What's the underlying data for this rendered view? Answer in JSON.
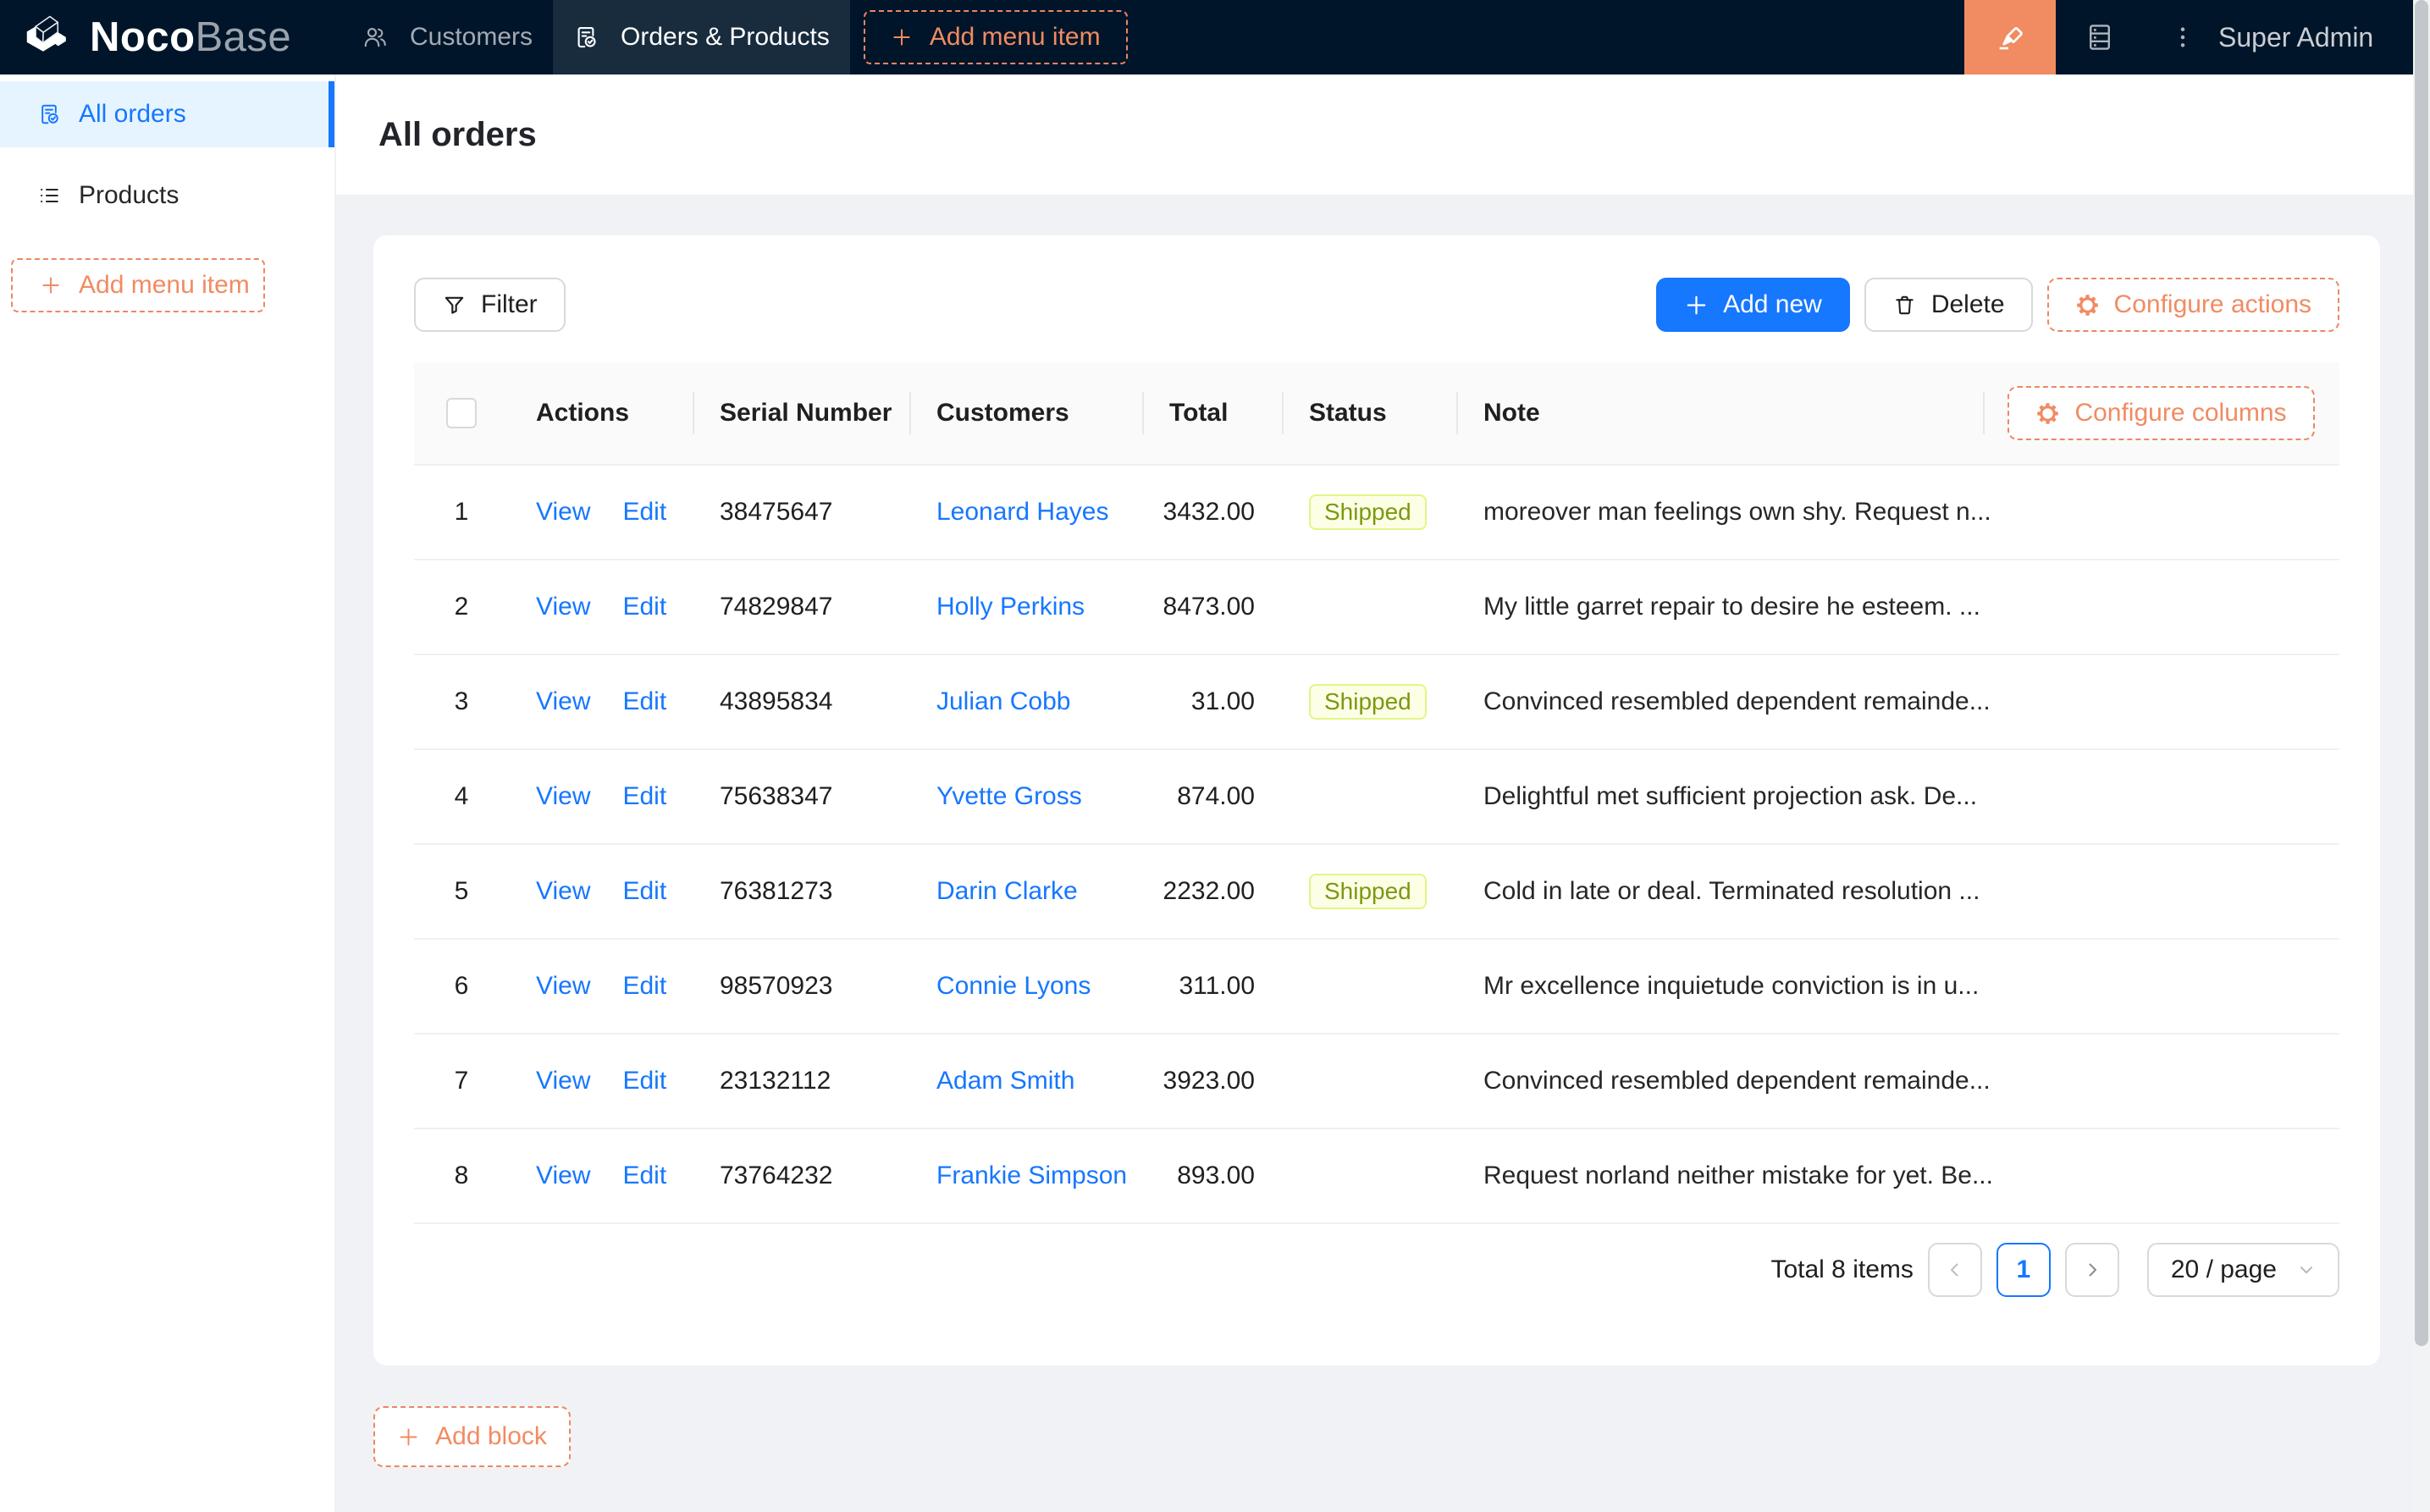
{
  "header": {
    "brand": {
      "bold": "Noco",
      "light": "Base"
    },
    "tabs": [
      {
        "label": "Customers",
        "icon": "team-icon",
        "active": false
      },
      {
        "label": "Orders & Products",
        "icon": "file-done-icon",
        "active": true
      }
    ],
    "add_menu_item": "Add menu item",
    "right": {
      "ui_editor_icon": "highlighter-icon",
      "database_icon": "database-icon",
      "more_icon": "kebab-icon",
      "user": "Super Admin"
    }
  },
  "sidebar": {
    "items": [
      {
        "label": "All orders",
        "icon": "file-done-icon",
        "active": true
      },
      {
        "label": "Products",
        "icon": "unordered-list-icon",
        "active": false
      }
    ],
    "add_menu_item": "Add menu item"
  },
  "page": {
    "title": "All orders"
  },
  "toolbar": {
    "filter": "Filter",
    "add_new": "Add new",
    "delete": "Delete",
    "configure_actions": "Configure actions"
  },
  "table": {
    "columns": {
      "actions": "Actions",
      "serial": "Serial Number",
      "customers": "Customers",
      "total": "Total",
      "status": "Status",
      "note": "Note"
    },
    "configure_columns": "Configure columns",
    "row_actions": {
      "view": "View",
      "edit": "Edit"
    },
    "rows": [
      {
        "index": "1",
        "serial": "38475647",
        "customer": "Leonard Hayes",
        "total": "3432.00",
        "status": "Shipped",
        "note": "moreover man feelings own shy. Request n..."
      },
      {
        "index": "2",
        "serial": "74829847",
        "customer": "Holly Perkins",
        "total": "8473.00",
        "status": "",
        "note": "My little garret repair to desire he esteem. ..."
      },
      {
        "index": "3",
        "serial": "43895834",
        "customer": "Julian Cobb",
        "total": "31.00",
        "status": "Shipped",
        "note": "Convinced resembled dependent remainde..."
      },
      {
        "index": "4",
        "serial": "75638347",
        "customer": "Yvette Gross",
        "total": "874.00",
        "status": "",
        "note": "Delightful met sufficient projection ask. De..."
      },
      {
        "index": "5",
        "serial": "76381273",
        "customer": "Darin Clarke",
        "total": "2232.00",
        "status": "Shipped",
        "note": "Cold in late or deal. Terminated resolution ..."
      },
      {
        "index": "6",
        "serial": "98570923",
        "customer": "Connie Lyons",
        "total": "311.00",
        "status": "",
        "note": "Mr excellence inquietude conviction is in u..."
      },
      {
        "index": "7",
        "serial": "23132112",
        "customer": "Adam Smith",
        "total": "3923.00",
        "status": "",
        "note": "Convinced resembled dependent remainde..."
      },
      {
        "index": "8",
        "serial": "73764232",
        "customer": "Frankie Simpson",
        "total": "893.00",
        "status": "",
        "note": "Request norland neither mistake for yet. Be..."
      }
    ]
  },
  "pagination": {
    "total": "Total 8 items",
    "prev_icon": "chevron-left-icon",
    "current_page": "1",
    "next_icon": "chevron-right-icon",
    "page_size": "20 / page"
  },
  "add_block": "Add block",
  "colors": {
    "topbar_bg": "#001529",
    "topbar_active_tab_bg": "#182c3e",
    "designer_orange": "#f18b62",
    "primary_blue": "#1677ff",
    "selected_menu_bg": "#e6f4ff",
    "tag_shipped_bg": "#fcffe6",
    "tag_shipped_border": "#e3f587",
    "tag_shipped_text": "#7c9810",
    "layout_bg": "#f0f2f5"
  }
}
